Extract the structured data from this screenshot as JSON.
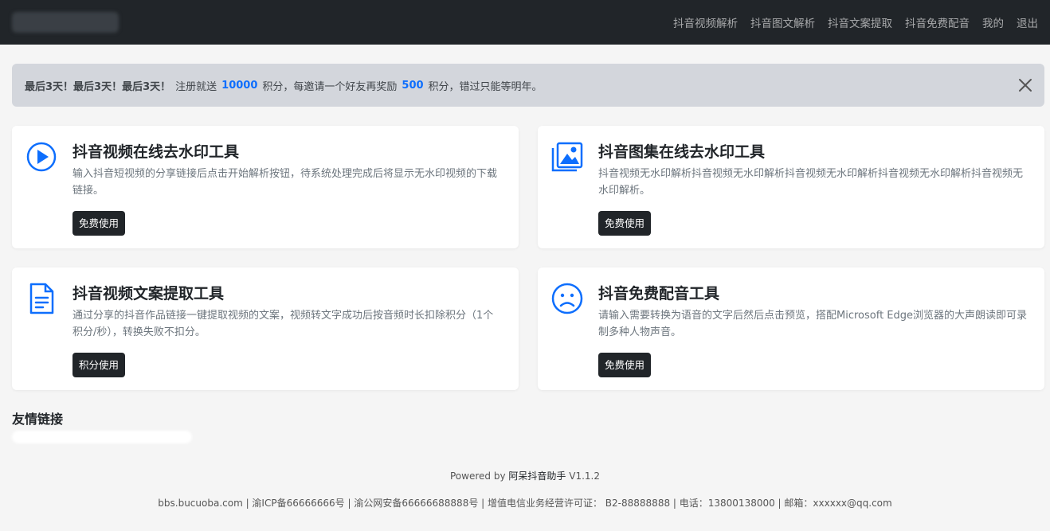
{
  "nav": {
    "links": [
      "抖音视频解析",
      "抖音图文解析",
      "抖音文案提取",
      "抖音免费配音",
      "我的",
      "退出"
    ]
  },
  "alert": {
    "prefix": "最后3天！最后3天！最后3天！",
    "text1": "注册就送",
    "num1": "10000",
    "text2": "积分，每邀请一个好友再奖励",
    "num2": "500",
    "text3": "积分，错过只能等明年。"
  },
  "cards": [
    {
      "icon": "play-circle-icon",
      "title": "抖音视频在线去水印工具",
      "desc": "输入抖音短视频的分享链接后点击开始解析按钮，待系统处理完成后将显示无水印视频的下载链接。",
      "button": "免费使用"
    },
    {
      "icon": "images-icon",
      "title": "抖音图集在线去水印工具",
      "desc": "抖音视频无水印解析抖音视频无水印解析抖音视频无水印解析抖音视频无水印解析抖音视频无水印解析。",
      "button": "免费使用"
    },
    {
      "icon": "file-text-icon",
      "title": "抖音视频文案提取工具",
      "desc": "通过分享的抖音作品链接一键提取视频的文案，视频转文字成功后按音频时长扣除积分（1个积分/秒），转换失败不扣分。",
      "button": "积分使用"
    },
    {
      "icon": "emoji-frown-icon",
      "title": "抖音免费配音工具",
      "desc": "请输入需要转换为语音的文字后然后点击预览，搭配Microsoft Edge浏览器的大声朗读即可录制多种人物声音。",
      "button": "免费使用"
    }
  ],
  "friends": {
    "title": "友情链接"
  },
  "powered": {
    "prefix": "Powered by",
    "app": "阿呆抖音助手",
    "version": "V1.1.2"
  },
  "footer": {
    "text": "bbs.bucuoba.com | 渝ICP备66666666号 | 渝公网安备66666688888号 | 增值电信业务经营许可证： B2-88888888 | 电话：13800138000 | 邮箱：xxxxxx@qq.com"
  },
  "colors": {
    "navbar": "#212529",
    "accent": "#0d6efd",
    "alert_bg": "#d3d6dc"
  }
}
